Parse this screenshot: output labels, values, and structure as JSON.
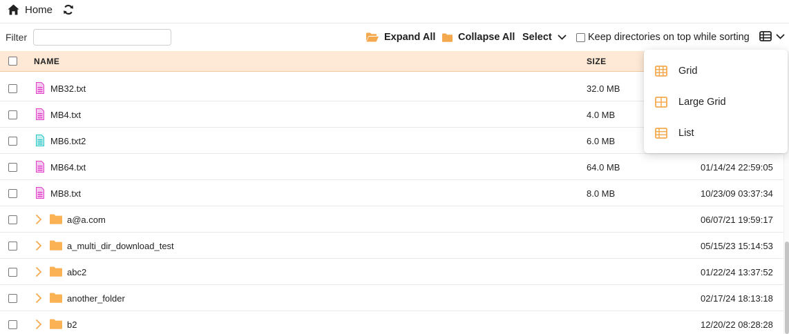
{
  "topbar": {
    "home_label": "Home",
    "home_icon": "home-icon",
    "refresh_icon": "refresh-icon"
  },
  "toolbar": {
    "filter_label": "Filter",
    "filter_value": "",
    "expand_all": "Expand All",
    "collapse_all": "Collapse All",
    "select": "Select",
    "keep_dirs_label": "Keep directories on top while sorting",
    "keep_dirs_checked": false
  },
  "table": {
    "headers": {
      "name": "NAME",
      "size": "SIZE"
    },
    "rows": [
      {
        "type": "file",
        "name": "MB32.txt",
        "size": "32.0 MB",
        "date": "",
        "icon_color": "#e040c8"
      },
      {
        "type": "file",
        "name": "MB4.txt",
        "size": "4.0 MB",
        "date": "",
        "icon_color": "#e040c8"
      },
      {
        "type": "file",
        "name": "MB6.txt2",
        "size": "6.0 MB",
        "date": "",
        "icon_color": "#26c6c6"
      },
      {
        "type": "file",
        "name": "MB64.txt",
        "size": "64.0 MB",
        "date": "01/14/24 22:59:05",
        "icon_color": "#e040c8"
      },
      {
        "type": "file",
        "name": "MB8.txt",
        "size": "8.0 MB",
        "date": "10/23/09 03:37:34",
        "icon_color": "#e040c8"
      },
      {
        "type": "dir",
        "name": "a@a.com",
        "size": "",
        "date": "06/07/21 19:59:17"
      },
      {
        "type": "dir",
        "name": "a_multi_dir_download_test",
        "size": "",
        "date": "05/15/23 15:14:53"
      },
      {
        "type": "dir",
        "name": "abc2",
        "size": "",
        "date": "01/22/24 13:37:52"
      },
      {
        "type": "dir",
        "name": "another_folder",
        "size": "",
        "date": "02/17/24 18:13:18"
      },
      {
        "type": "dir",
        "name": "b2",
        "size": "",
        "date": "12/20/22 08:28:28"
      }
    ]
  },
  "view_menu": {
    "items": [
      {
        "label": "Grid",
        "icon": "grid-icon"
      },
      {
        "label": "Large Grid",
        "icon": "large-grid-icon"
      },
      {
        "label": "List",
        "icon": "list-icon"
      }
    ]
  },
  "colors": {
    "accent": "#f5a94e",
    "header_bg": "#fde9d6",
    "folder": "#fbb254"
  }
}
